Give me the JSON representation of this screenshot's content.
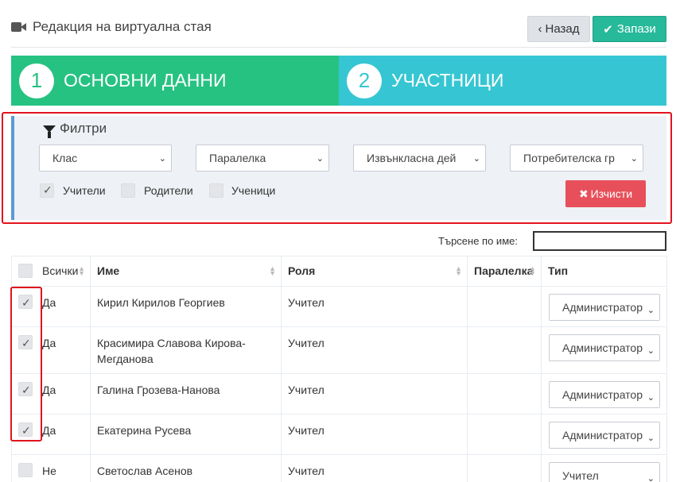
{
  "header": {
    "title": "Редакция на виртуална стая",
    "back_label": "Назад",
    "save_label": "Запази"
  },
  "wizard": [
    {
      "number": "1",
      "label": "ОСНОВНИ ДАННИ"
    },
    {
      "number": "2",
      "label": "УЧАСТНИЦИ"
    }
  ],
  "filters": {
    "title": "Филтри",
    "selects": [
      "Клас",
      "Паралелка",
      "Извънкласна дей",
      "Потребителска гр"
    ],
    "checkboxes": [
      {
        "label": "Учители",
        "checked": true
      },
      {
        "label": "Родители",
        "checked": false
      },
      {
        "label": "Ученици",
        "checked": false
      }
    ],
    "clear_label": "Изчисти"
  },
  "search": {
    "label": "Търсене по име:",
    "value": ""
  },
  "table": {
    "columns": [
      "Всички",
      "Име",
      "Роля",
      "Паралелка",
      "Тип"
    ],
    "rows": [
      {
        "checked": true,
        "yn": "Да",
        "name": "Кирил Кирилов Георгиев",
        "role": "Учител",
        "class": "",
        "type": "Администратор"
      },
      {
        "checked": true,
        "yn": "Да",
        "name": "Красимира Славова Кирова-Мегданова",
        "role": "Учител",
        "class": "",
        "type": "Администратор"
      },
      {
        "checked": true,
        "yn": "Да",
        "name": "Галина Грозева-Нанова",
        "role": "Учител",
        "class": "",
        "type": "Администратор"
      },
      {
        "checked": true,
        "yn": "Да",
        "name": "Екатерина Русева",
        "role": "Учител",
        "class": "",
        "type": "Администратор"
      },
      {
        "checked": false,
        "yn": "Не",
        "name": "Светослав Асенов",
        "role": "Учител",
        "class": "",
        "type": "Учител"
      }
    ]
  },
  "colors": {
    "step1": "#26c281",
    "step2": "#36c6d3",
    "save": "#26b99a",
    "clear": "#e7505a",
    "highlight": "#e0141e"
  }
}
